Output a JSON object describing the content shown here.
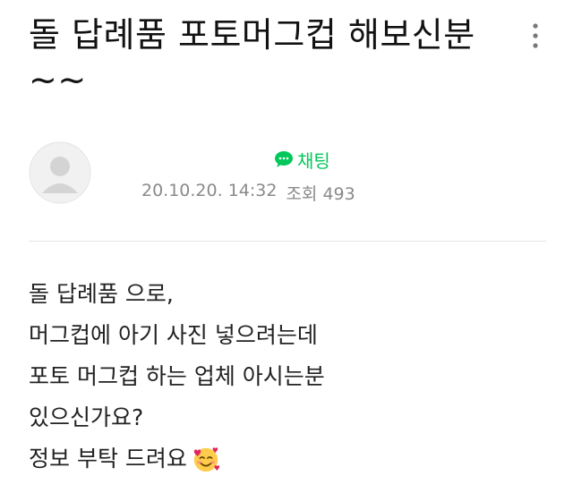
{
  "post": {
    "title": "돌 답례품 포토머그컵 해보신분~~",
    "author_name": "",
    "chat_label": "채팅",
    "date": "20.10.20. 14:32",
    "views_label": "조회 493",
    "body_lines": [
      "돌 답례품 으로,",
      "머그컵에 아기 사진 넣으려는데",
      "포토 머그컵 하는 업체 아시는분",
      "있으신가요?",
      "정보 부탁 드려요"
    ]
  },
  "icons": {
    "more": "more-vertical-icon",
    "avatar": "default-avatar-icon",
    "chat": "chat-bubble-icon",
    "emoji": "smiling-face-with-hearts-emoji"
  },
  "colors": {
    "accent_green": "#03c75a",
    "meta_gray": "#8a8a8a",
    "divider": "#e3e3e3"
  }
}
